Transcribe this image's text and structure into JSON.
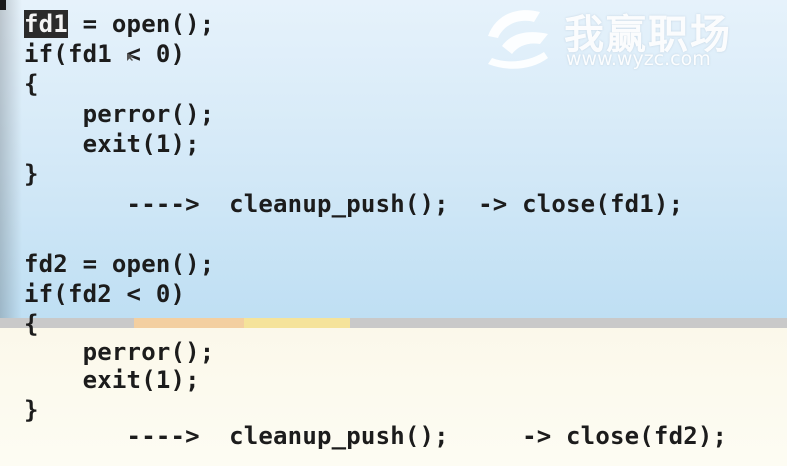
{
  "editor": {
    "lines": {
      "l1_hl": "fd1",
      "l1_sel": " = open(",
      "l1_rest": ");",
      "l2": "if(fd1 < 0)",
      "l3": "{",
      "l4": "    perror();",
      "l5": "    exit(1);",
      "l6": "}",
      "l7": "       ---->  cleanup_push();  -> close(fd1);",
      "l8": "fd2 = open();",
      "l9": "if(fd2 < 0)",
      "l10": "{",
      "l11": "    perror();",
      "l12": "    exit(1);",
      "l13": "}",
      "l14": "       ---->  cleanup_push();     -> close(fd2);"
    }
  },
  "watermark": {
    "title": "我赢职场",
    "url": "www.wyzc.com"
  },
  "colors": {
    "strip": [
      "#f3cfa0",
      "#f5e39a",
      "#c9c9c9"
    ]
  }
}
